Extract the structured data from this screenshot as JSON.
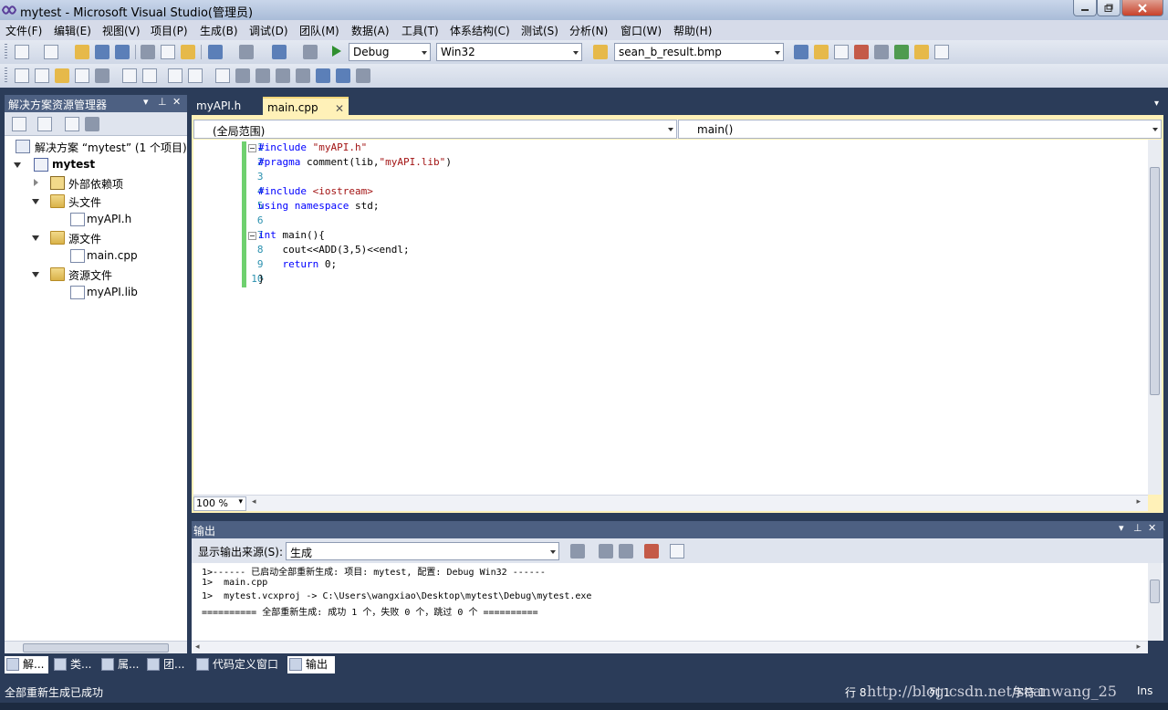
{
  "window": {
    "title": "mytest - Microsoft Visual Studio(管理员)"
  },
  "menu": [
    "文件(F)",
    "编辑(E)",
    "视图(V)",
    "项目(P)",
    "生成(B)",
    "调试(D)",
    "团队(M)",
    "数据(A)",
    "工具(T)",
    "体系结构(C)",
    "测试(S)",
    "分析(N)",
    "窗口(W)",
    "帮助(H)"
  ],
  "toolbar": {
    "config": "Debug",
    "platform": "Win32",
    "find_combo": "sean_b_result.bmp"
  },
  "solution_explorer": {
    "title": "解决方案资源管理器",
    "tree": [
      {
        "label": "解决方案 “mytest” (1 个项目)",
        "icon": "solution-icon",
        "bold": false
      },
      {
        "label": "mytest",
        "icon": "project-icon",
        "bold": true
      },
      {
        "label": "外部依赖项",
        "icon": "references-icon",
        "bold": false
      },
      {
        "label": "头文件",
        "icon": "folder-icon",
        "bold": false
      },
      {
        "label": "myAPI.h",
        "icon": "header-file-icon",
        "bold": false
      },
      {
        "label": "源文件",
        "icon": "folder-icon",
        "bold": false
      },
      {
        "label": "main.cpp",
        "icon": "cpp-file-icon",
        "bold": false
      },
      {
        "label": "资源文件",
        "icon": "folder-icon",
        "bold": false
      },
      {
        "label": "myAPI.lib",
        "icon": "lib-file-icon",
        "bold": false
      }
    ]
  },
  "editor": {
    "tabs": [
      {
        "label": "myAPI.h",
        "active": false
      },
      {
        "label": "main.cpp",
        "active": true
      }
    ],
    "scope": "(全局范围)",
    "member": "main()",
    "zoom": "100 %",
    "lines": [
      {
        "n": "1",
        "text": "#include \"myAPI.h\""
      },
      {
        "n": "2",
        "text": "#pragma comment(lib,\"myAPI.lib\")"
      },
      {
        "n": "3",
        "text": ""
      },
      {
        "n": "4",
        "text": "#include <iostream>"
      },
      {
        "n": "5",
        "text": "using namespace std;"
      },
      {
        "n": "6",
        "text": ""
      },
      {
        "n": "7",
        "text": "int main(){"
      },
      {
        "n": "8",
        "text": "    cout<<ADD(3,5)<<endl;"
      },
      {
        "n": "9",
        "text": "    return 0;"
      },
      {
        "n": "10",
        "text": "}"
      }
    ]
  },
  "output": {
    "title": "输出",
    "source_label": "显示输出来源(S):",
    "source_value": "生成",
    "lines": [
      "1>------ 已启动全部重新生成: 项目: mytest, 配置: Debug Win32 ------",
      "1>  main.cpp",
      "1>  mytest.vcxproj -> C:\\Users\\wangxiao\\Desktop\\mytest\\Debug\\mytest.exe",
      "========== 全部重新生成: 成功 1 个，失败 0 个，跳过 0 个 =========="
    ]
  },
  "bottom_tabs": [
    "解...",
    "类...",
    "属...",
    "团...",
    "代码定义窗口",
    "输出"
  ],
  "status": {
    "message": "全部重新生成已成功",
    "row": "行 8",
    "col": "列 1",
    "char": "字符 1",
    "ins": "Ins"
  },
  "watermark": "http://blog.csdn.net/seanwang_25"
}
